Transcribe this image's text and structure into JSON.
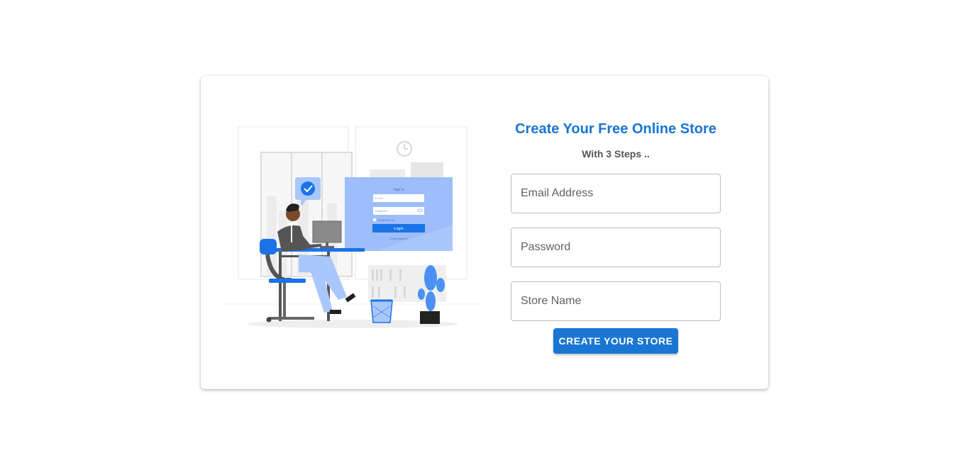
{
  "header": {
    "title": "Create Your Free Online Store",
    "subtitle": "With 3 Steps .."
  },
  "form": {
    "email_placeholder": "Email Address",
    "password_placeholder": "Password",
    "store_placeholder": "Store Name",
    "submit_label": "CREATE YOUR STORE"
  },
  "illustration": {
    "signin_title": "Sign in",
    "email_field": "E-mail",
    "password_field": "Password",
    "remember": "Remember me",
    "login_button": "Login",
    "forgot": "Forgot Password?"
  },
  "colors": {
    "accent": "#1976d2",
    "illustration_blue": "#4a90f5",
    "illustration_light_blue": "#a9c7fb"
  }
}
